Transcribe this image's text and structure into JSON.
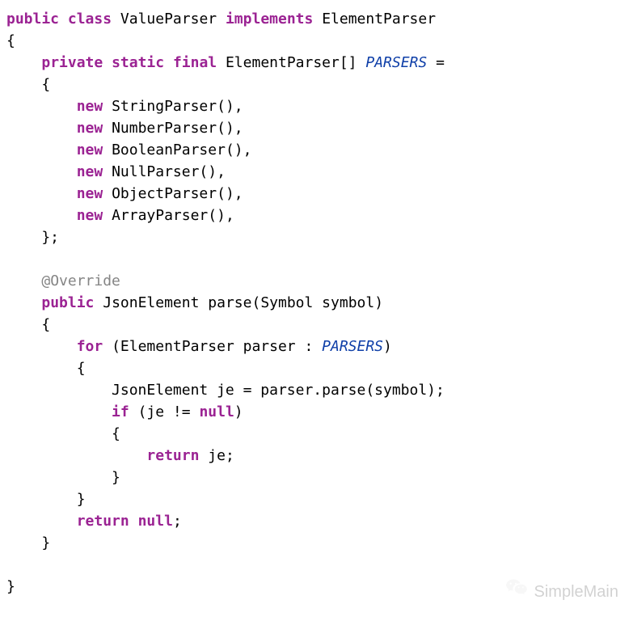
{
  "code": {
    "line1": {
      "public": "public",
      "class": "class",
      "className": "ValueParser",
      "implements": "implements",
      "interface": "ElementParser"
    },
    "line2": "{",
    "line3": {
      "private": "private",
      "static": "static",
      "final": "final",
      "type": "ElementParser[]",
      "name": "PARSERS",
      "eq": "="
    },
    "line4": "    {",
    "line5": {
      "new": "new",
      "call": "StringParser(),"
    },
    "line6": {
      "new": "new",
      "call": "NumberParser(),"
    },
    "line7": {
      "new": "new",
      "call": "BooleanParser(),"
    },
    "line8": {
      "new": "new",
      "call": "NullParser(),"
    },
    "line9": {
      "new": "new",
      "call": "ObjectParser(),"
    },
    "line10": {
      "new": "new",
      "call": "ArrayParser(),"
    },
    "line11": "    };",
    "line12": "",
    "line13": {
      "annot": "@Override"
    },
    "line14": {
      "public": "public",
      "retType": "JsonElement",
      "method": "parse(Symbol symbol)"
    },
    "line15": "    {",
    "line16": {
      "for": "for",
      "open": "(ElementParser parser : ",
      "parsers": "PARSERS",
      "close": ")"
    },
    "line17": "        {",
    "line18": {
      "stmt": "JsonElement je = parser.parse(symbol);"
    },
    "line19": {
      "if": "if",
      "cond": "(je != ",
      "null": "null",
      "close": ")"
    },
    "line20": "            {",
    "line21": {
      "return": "return",
      "val": "je;"
    },
    "line22": "            }",
    "line23": "        }",
    "line24": {
      "return": "return",
      "null": "null",
      "semi": ";"
    },
    "line25": "    }",
    "line26": "",
    "line27": "}"
  },
  "watermark": {
    "text": "SimpleMain"
  }
}
